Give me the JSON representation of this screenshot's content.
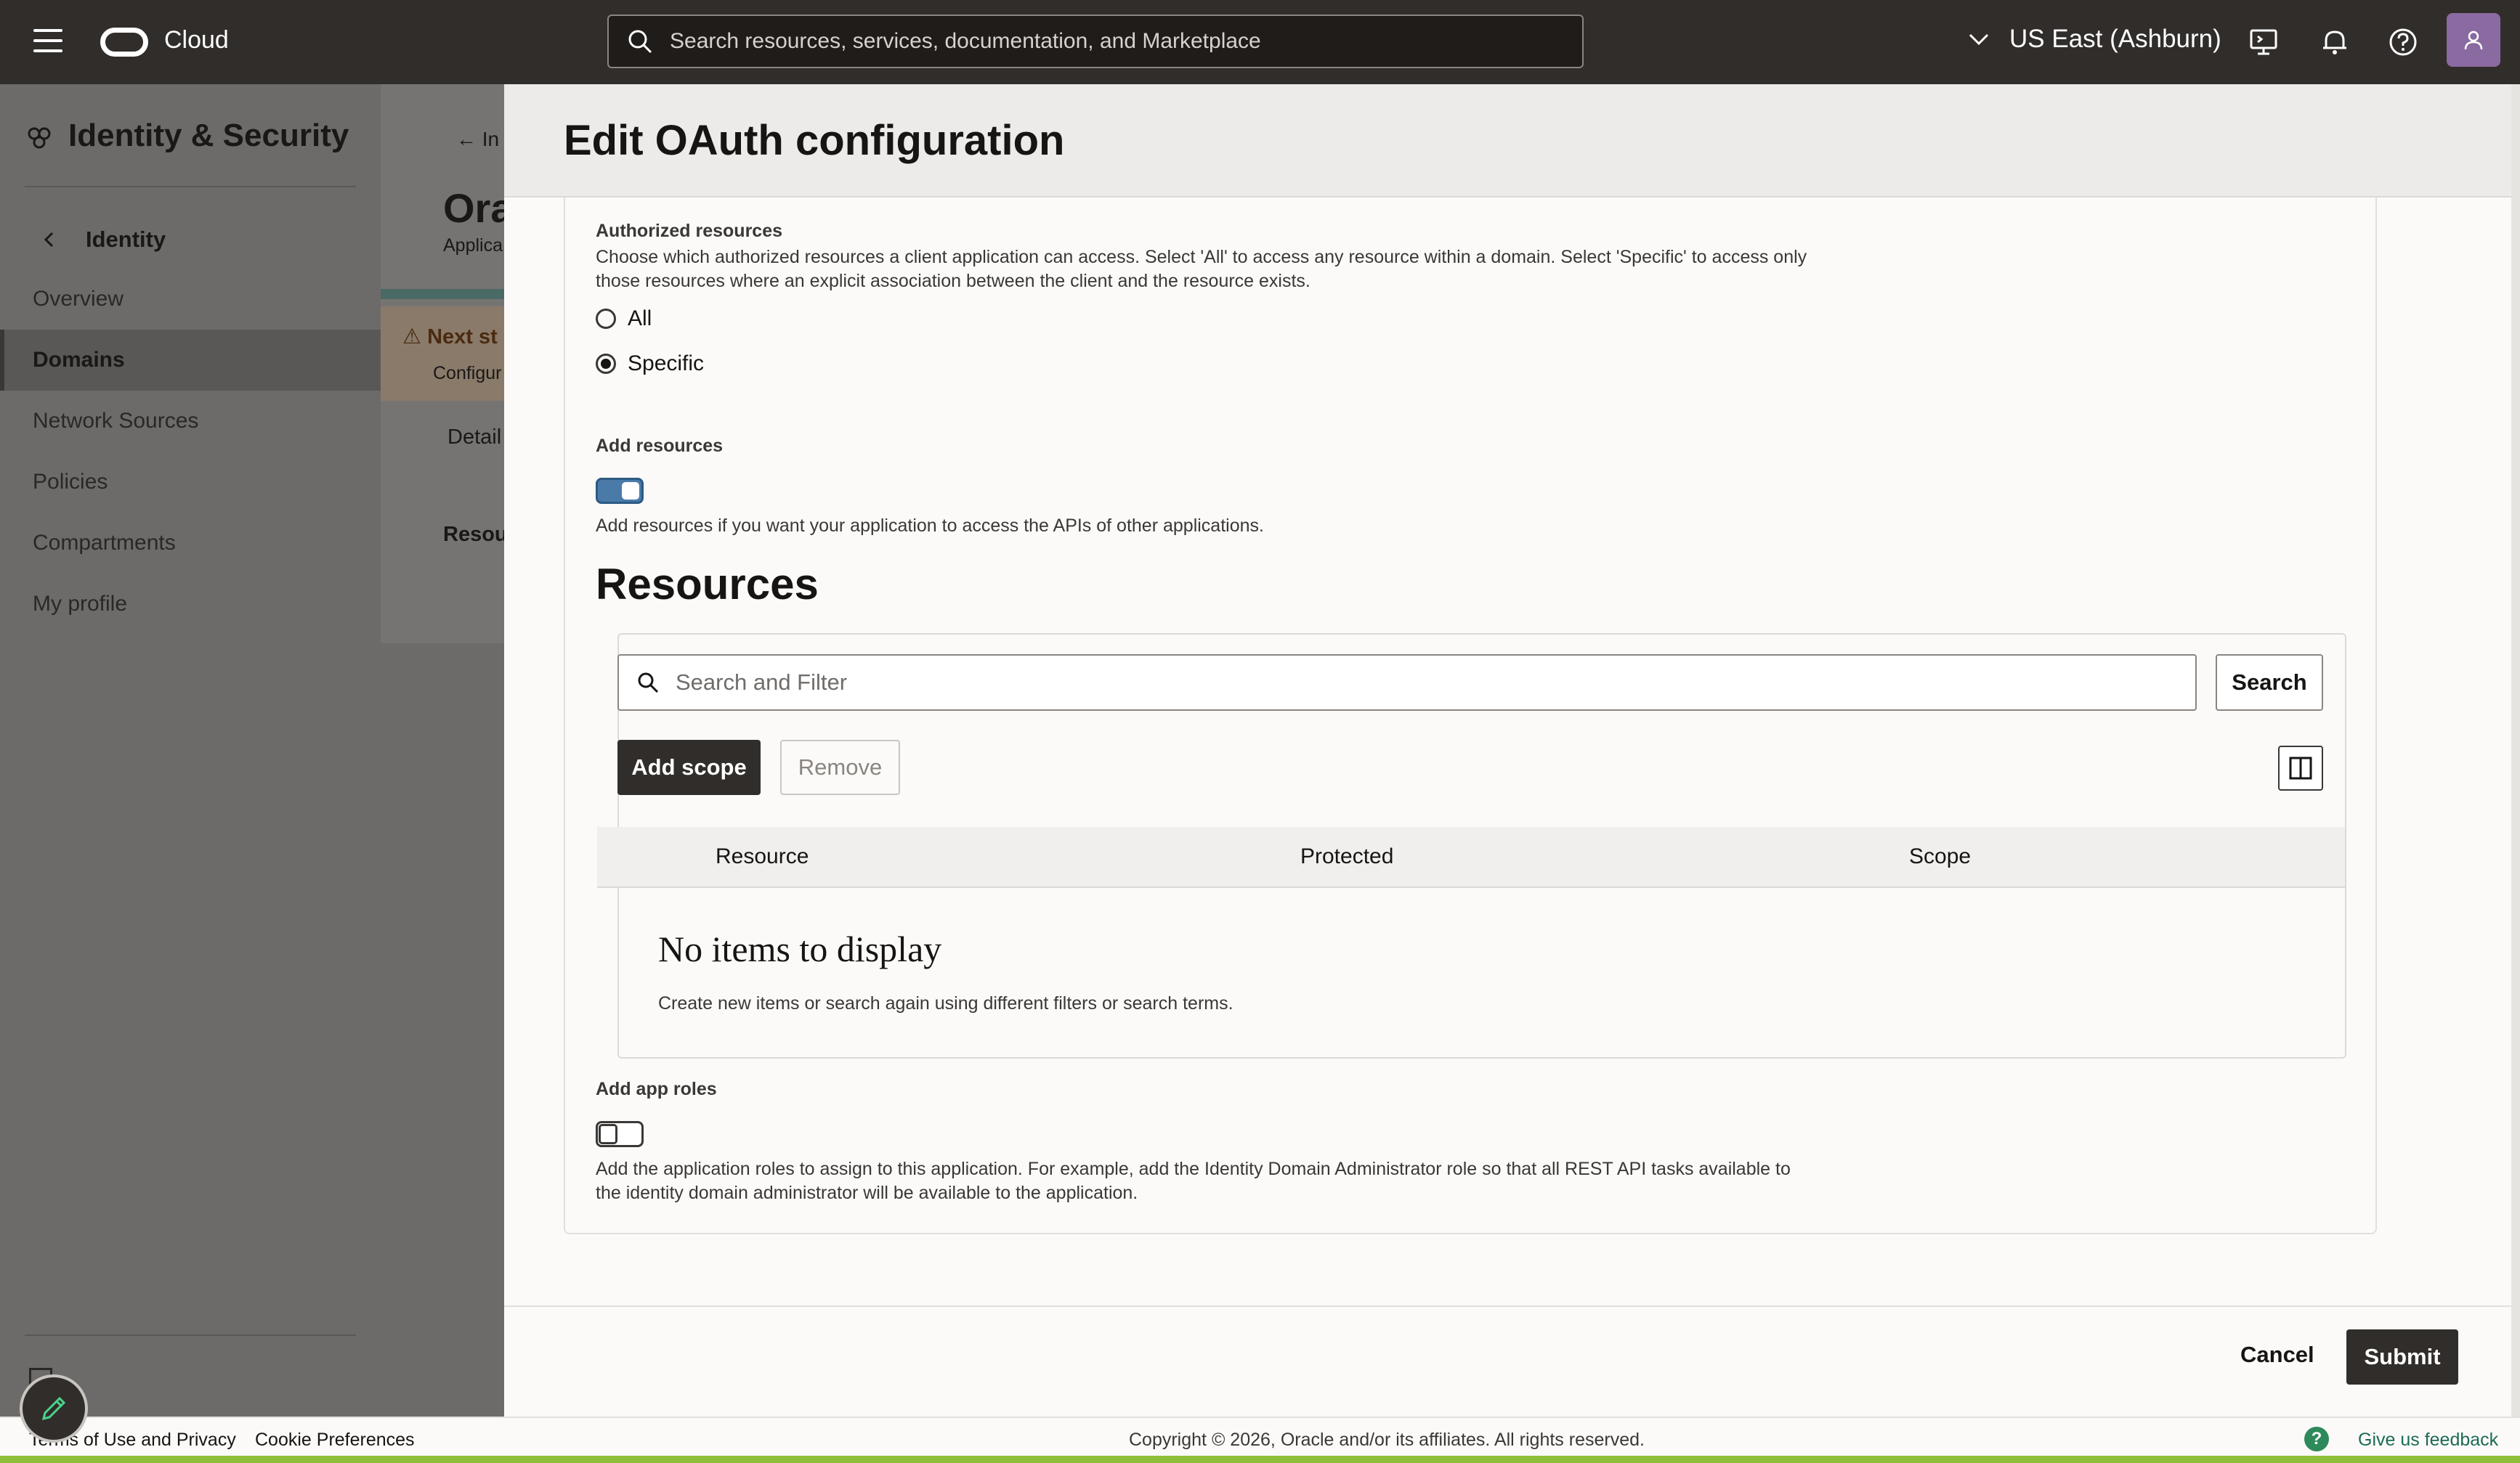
{
  "topbar": {
    "brand": "Cloud",
    "search_placeholder": "Search resources, services, documentation, and Marketplace",
    "region": "US East (Ashburn)"
  },
  "leftnav": {
    "title": "Identity & Security",
    "back_label": "Identity",
    "items": [
      {
        "label": "Overview",
        "active": false
      },
      {
        "label": "Domains",
        "active": true
      },
      {
        "label": "Network Sources",
        "active": false
      },
      {
        "label": "Policies",
        "active": false
      },
      {
        "label": "Compartments",
        "active": false
      },
      {
        "label": "My profile",
        "active": false
      }
    ]
  },
  "bgpage": {
    "back_text": "In",
    "title": "Ora",
    "subtitle": "Applica",
    "warning_title": "Next st",
    "warning_desc": "Configur",
    "tab": "Detail",
    "section": "Resou"
  },
  "drawer": {
    "title": "Edit OAuth configuration",
    "authorized_resources": {
      "label": "Authorized resources",
      "desc_line1": "Choose which authorized resources a client application can access. Select 'All' to access any resource within a domain. Select 'Specific' to access only",
      "desc_line2": "those resources where an explicit association between the client and the resource exists.",
      "options": [
        {
          "label": "All",
          "selected": false
        },
        {
          "label": "Specific",
          "selected": true
        }
      ]
    },
    "add_resources": {
      "label": "Add resources",
      "enabled": true,
      "desc": "Add resources if you want your application to access the APIs of other applications."
    },
    "resources": {
      "heading": "Resources",
      "filter_placeholder": "Search and Filter",
      "search_label": "Search",
      "add_scope_label": "Add scope",
      "remove_label": "Remove",
      "columns": [
        "Resource",
        "Protected",
        "Scope"
      ],
      "empty_title": "No items to display",
      "empty_desc": "Create new items or search again using different filters or search terms."
    },
    "add_app_roles": {
      "label": "Add app roles",
      "enabled": false,
      "desc_line1": "Add the application roles to assign to this application. For example, add the Identity Domain Administrator role so that all REST API tasks available to",
      "desc_line2": "the identity domain administrator will be available to the application."
    },
    "footer": {
      "cancel_label": "Cancel",
      "submit_label": "Submit"
    }
  },
  "bottombar": {
    "terms": "Terms of Use and Privacy",
    "cookies": "Cookie Preferences",
    "copyright": "Copyright © 2026, Oracle and/or its affiliates. All rights reserved.",
    "feedback": "Give us feedback",
    "help_glyph": "?"
  },
  "colors": {
    "topbar": "#312d2a",
    "toggle_on": "#4a7aa8",
    "accent_green": "#8fbf3a",
    "feedback_link": "#1d6b55"
  }
}
